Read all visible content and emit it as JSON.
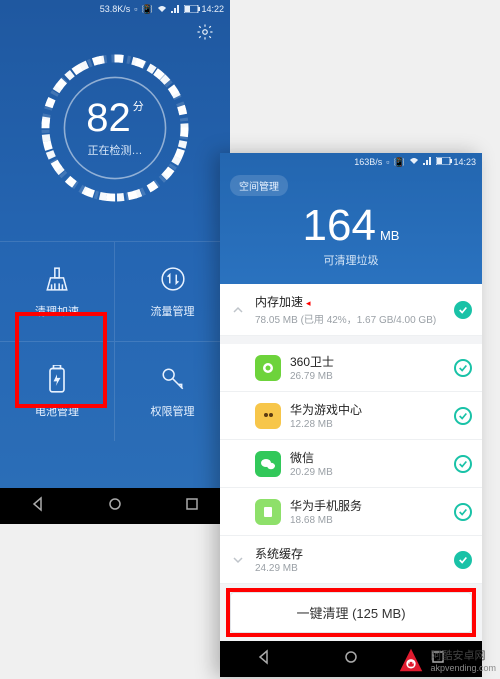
{
  "left": {
    "status": {
      "speed": "53.8K/s",
      "time": "14:22",
      "battery": "38"
    },
    "score": "82",
    "score_unit": "分",
    "status_text": "正在检测…",
    "grid": [
      {
        "id": "clean-accel",
        "label": "清理加速"
      },
      {
        "id": "traffic-mgr",
        "label": "流量管理"
      },
      {
        "id": "battery-mgr",
        "label": "电池管理"
      },
      {
        "id": "permission-mgr",
        "label": "权限管理"
      }
    ]
  },
  "right": {
    "status": {
      "speed": "163B/s",
      "time": "14:23",
      "battery": "37"
    },
    "chip": "空间管理",
    "total": "164",
    "total_unit": "MB",
    "total_sub": "可清理垃圾",
    "memory": {
      "title": "内存加速",
      "sub": "78.05 MB (已用 42%，1.67 GB/4.00 GB)"
    },
    "apps": [
      {
        "id": "360",
        "name": "360卫士",
        "size": "26.79 MB",
        "color": "#6dd33b"
      },
      {
        "id": "hw-game",
        "name": "华为游戏中心",
        "size": "12.28 MB",
        "color": "#f7c64a"
      },
      {
        "id": "wechat",
        "name": "微信",
        "size": "20.29 MB",
        "color": "#32c85a"
      },
      {
        "id": "hw-service",
        "name": "华为手机服务",
        "size": "18.68 MB",
        "color": "#8ee06a"
      },
      {
        "id": "sys-cache",
        "name": "系统缓存",
        "size": "24.29 MB",
        "color": ""
      }
    ],
    "button": "一键清理 (125 MB)"
  },
  "watermark": {
    "brand": "阿酷安卓网",
    "url": "akpvending.com"
  }
}
